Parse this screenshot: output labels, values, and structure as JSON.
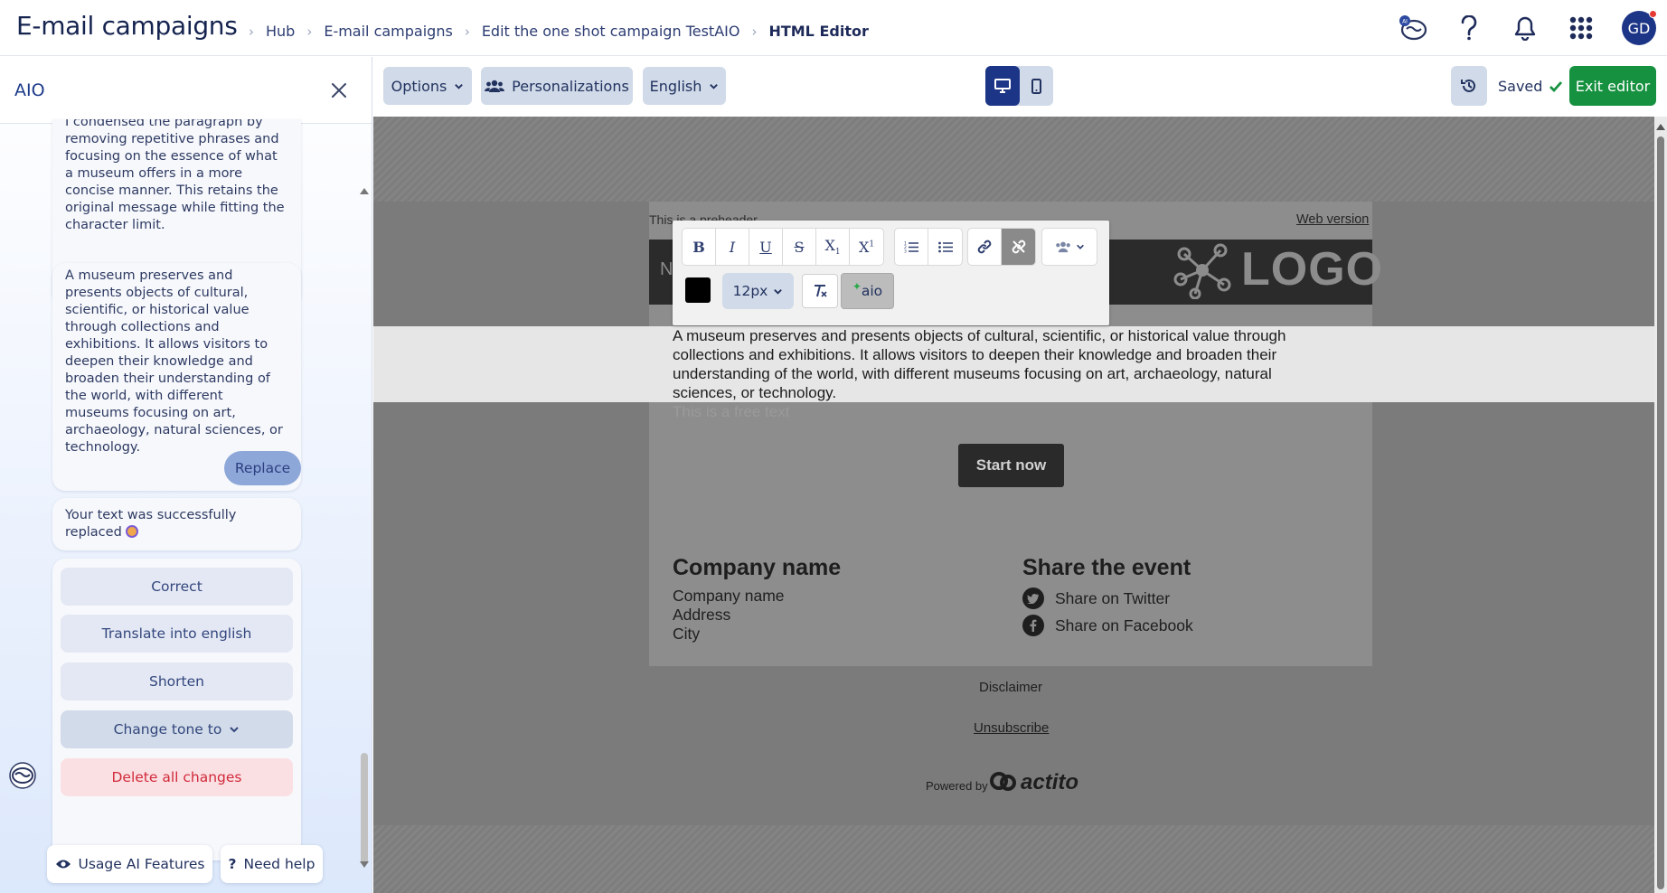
{
  "header": {
    "app_title": "E-mail campaigns",
    "breadcrumbs": [
      "Hub",
      "E-mail campaigns",
      "Edit the one shot campaign TestAIO",
      "HTML Editor"
    ],
    "avatar_initials": "GD",
    "icons": [
      "aio-assistant-icon",
      "help-icon",
      "bell-icon",
      "apps-grid-icon"
    ]
  },
  "sidebar": {
    "title": "AIO",
    "messages": [
      "I condensed the paragraph by removing repetitive phrases and focusing on the essence of what a museum offers in a more concise manner. This retains the original message while fitting the character limit.",
      "A museum preserves and presents objects of cultural, scientific, or historical value through collections and exhibitions. It allows visitors to deepen their knowledge and broaden their understanding of the world, with different museums focusing on art, archaeology, natural sciences, or technology."
    ],
    "replace_label": "Replace",
    "status_message": "Your text was successfully replaced",
    "actions": {
      "correct": "Correct",
      "translate": "Translate into english",
      "shorten": "Shorten",
      "change_tone": "Change tone to",
      "delete": "Delete all changes"
    },
    "footer": {
      "usage": "Usage AI Features",
      "help": "Need help"
    }
  },
  "toolbar": {
    "options": "Options",
    "personalizations": "Personalizations",
    "language": "English",
    "saved": "Saved",
    "exit": "Exit editor"
  },
  "rte": {
    "font_size": "12px",
    "aio": "aio",
    "text_color": "#000000"
  },
  "email": {
    "preheader": "This is a preheader",
    "web_version": "Web version",
    "banner_letter": "N",
    "logo": "LOGO",
    "body": "A museum preserves and presents objects of cultural, scientific, or historical value through collections and exhibitions. It allows visitors to deepen their knowledge and broaden their understanding of the world, with different museums focusing on art, archaeology, natural sciences, or technology.",
    "faded_line": "This is a free text",
    "cta": "Start now",
    "company_heading": "Company name",
    "company_lines": [
      "Company name",
      "Address",
      "City"
    ],
    "share_heading": "Share the event",
    "share_twitter": "Share on Twitter",
    "share_facebook": "Share on Facebook",
    "disclaimer": "Disclaimer",
    "unsubscribe": "Unsubscribe",
    "powered_by": "Powered by",
    "brand": "actito"
  },
  "colors": {
    "accent": "#1c3586",
    "exit_green": "#16913f",
    "saved_check": "#16913f",
    "delete_red": "#d02a3a"
  }
}
